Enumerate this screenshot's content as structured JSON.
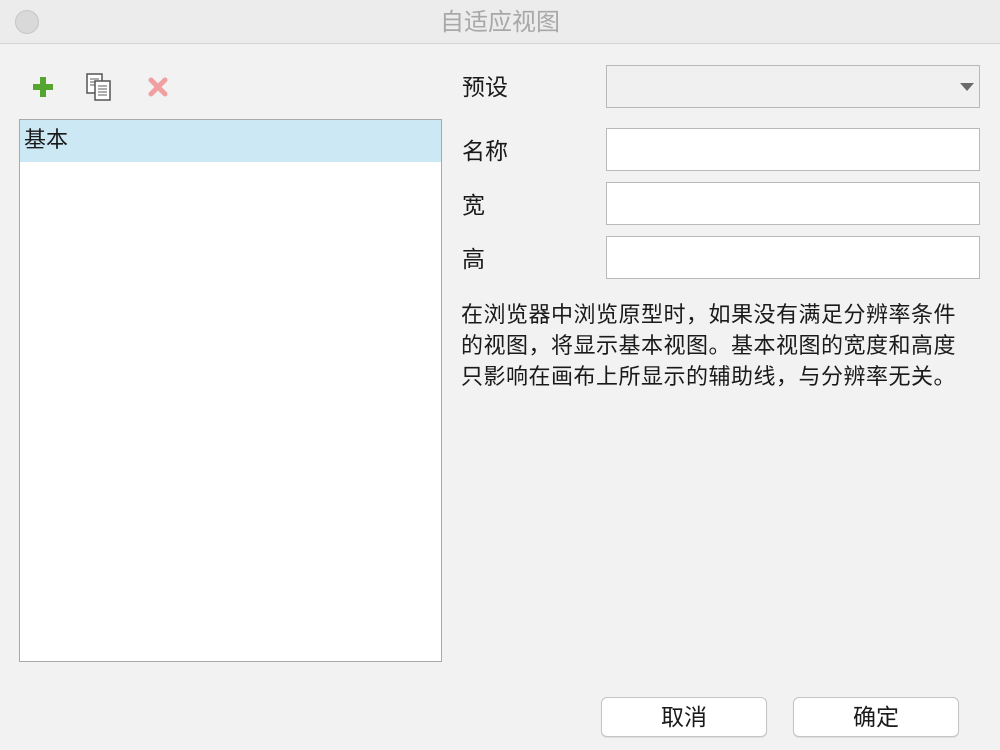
{
  "window": {
    "title": "自适应视图"
  },
  "toolbar": {
    "add_icon": "plus-icon",
    "duplicate_icon": "copy-icon",
    "delete_icon": "close-icon",
    "add_color": "#55a630",
    "delete_color": "#f0a0a0"
  },
  "views_list": {
    "items": [
      {
        "label": "基本",
        "selected": true
      }
    ],
    "selected_color": "#cde8f5"
  },
  "form": {
    "preset_label": "预设",
    "preset_value": "",
    "name_label": "名称",
    "name_value": "",
    "width_label": "宽",
    "width_value": "",
    "height_label": "高",
    "height_value": ""
  },
  "description": "在浏览器中浏览原型时，如果没有满足分辨率条件的视图，将显示基本视图。基本视图的宽度和高度只影响在画布上所显示的辅助线，与分辨率无关。",
  "buttons": {
    "cancel_label": "取消",
    "ok_label": "确定"
  }
}
